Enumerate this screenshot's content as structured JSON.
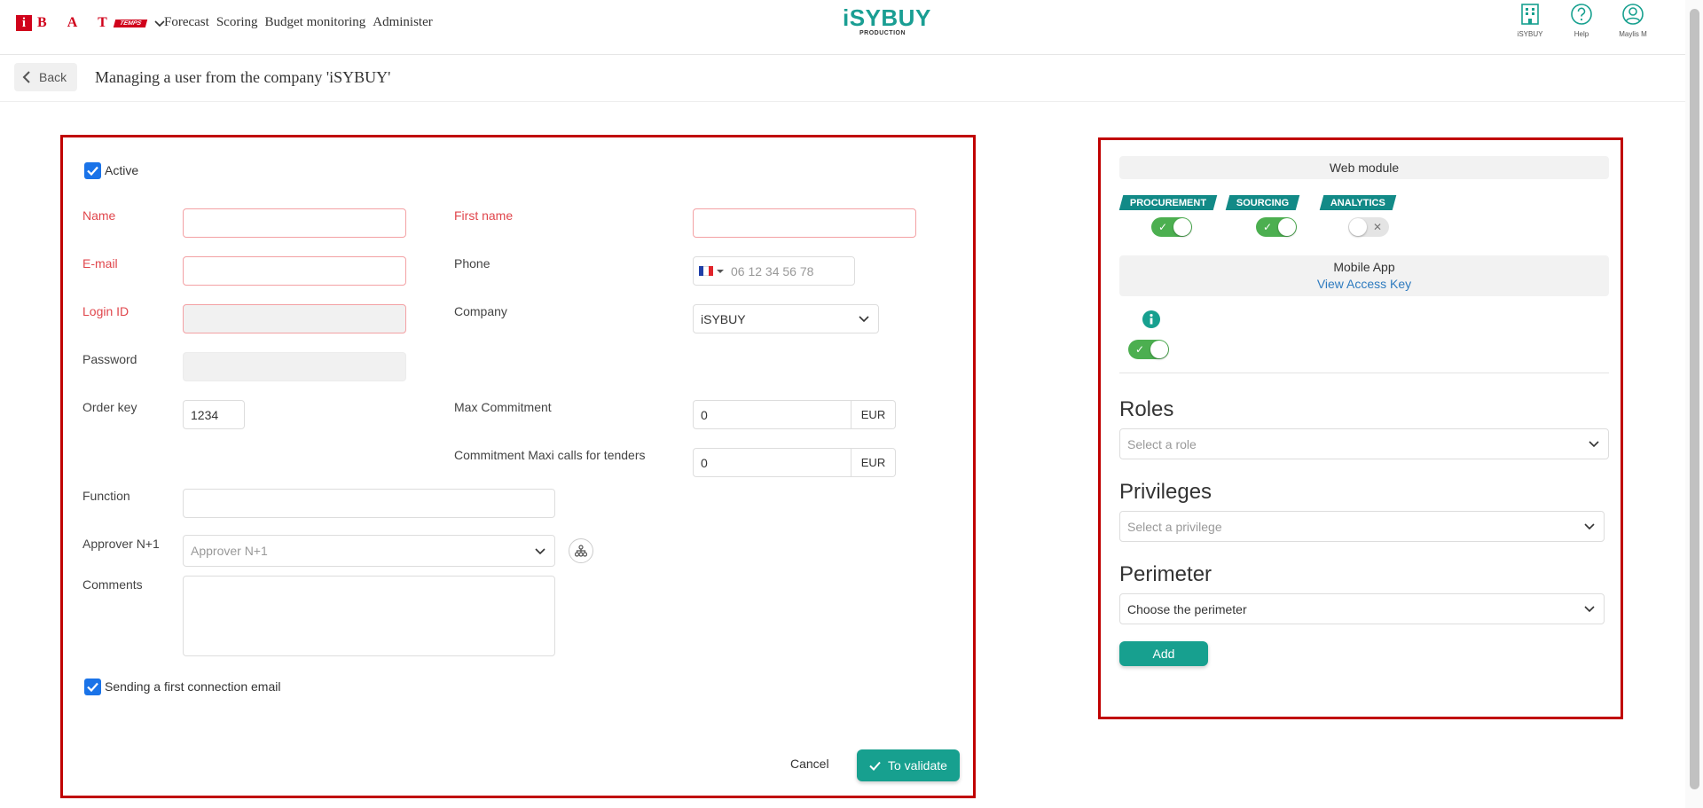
{
  "topbar": {
    "logo_letters": "B A T",
    "logo_badge": "TEMPS",
    "nav": [
      "Forecast",
      "Scoring",
      "Budget monitoring",
      "Administer"
    ],
    "brand_name": "iSYBUY",
    "brand_sub": "PRODUCTION",
    "icons": [
      {
        "label": "iSYBUY",
        "icon": "building-icon"
      },
      {
        "label": "Help",
        "icon": "help-icon"
      },
      {
        "label": "Maylis M",
        "icon": "user-icon"
      }
    ]
  },
  "subbar": {
    "back_label": "Back",
    "title": "Managing a user from the company 'iSYBUY'"
  },
  "form": {
    "active_label": "Active",
    "active_checked": true,
    "name_label": "Name",
    "name_value": "",
    "firstname_label": "First name",
    "firstname_value": "",
    "email_label": "E-mail",
    "email_value": "",
    "phone_label": "Phone",
    "phone_placeholder": "06 12 34 56 78",
    "login_label": "Login ID",
    "login_value": "",
    "company_label": "Company",
    "company_value": "iSYBUY",
    "password_label": "Password",
    "orderkey_label": "Order key",
    "orderkey_value": "1234",
    "maxcommit_label": "Max Commitment",
    "maxcommit_value": "0",
    "maxcommit_currency": "EUR",
    "tender_label": "Commitment Maxi calls for tenders",
    "tender_value": "0",
    "tender_currency": "EUR",
    "function_label": "Function",
    "function_value": "",
    "approver_label": "Approver N+1",
    "approver_placeholder": "Approver N+1",
    "comments_label": "Comments",
    "comments_value": "",
    "sendmail_label": "Sending a first connection email",
    "sendmail_checked": true,
    "cancel_label": "Cancel",
    "validate_label": "To validate"
  },
  "modules": {
    "web_title": "Web module",
    "items": [
      {
        "label": "PROCUREMENT",
        "on": true
      },
      {
        "label": "SOURCING",
        "on": true
      },
      {
        "label": "ANALYTICS",
        "on": false
      }
    ],
    "mobile_title": "Mobile App",
    "access_key_link": "View Access Key",
    "mobile_on": true
  },
  "roles": {
    "roles_title": "Roles",
    "roles_placeholder": "Select a role",
    "privileges_title": "Privileges",
    "privileges_placeholder": "Select a privilege",
    "perimeter_title": "Perimeter",
    "perimeter_value": "Choose the perimeter",
    "add_label": "Add"
  },
  "colors": {
    "accent": "#17a08f",
    "required": "#e0464c",
    "highlight_border": "#c00000",
    "toggle_on": "#4caf50",
    "logo_red": "#d0021b"
  }
}
